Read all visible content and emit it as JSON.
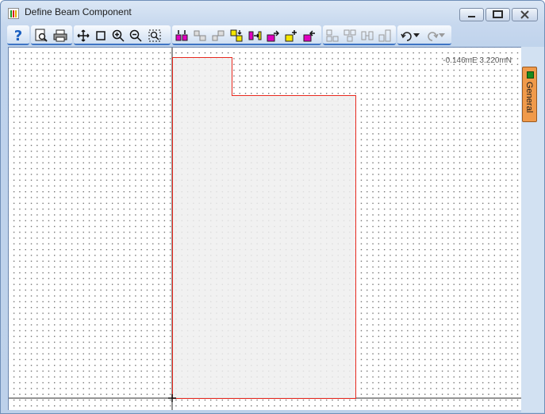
{
  "window": {
    "title": "Define Beam Component"
  },
  "toolbar": {
    "groups": [
      {
        "items": [
          "help-icon"
        ]
      },
      {
        "items": [
          "print-preview-icon",
          "print-icon"
        ]
      },
      {
        "items": [
          "pan-icon",
          "zoom-window-icon",
          "zoom-in-icon",
          "zoom-out-icon",
          "zoom-extents-icon"
        ]
      },
      {
        "items": [
          "tool-1-icon",
          "tool-2-icon",
          "tool-3-icon",
          "tool-4-icon",
          "tool-5-icon",
          "tool-6-icon",
          "tool-7-icon",
          "tool-8-icon"
        ]
      },
      {
        "items": [
          "disabled-tool-1-icon",
          "disabled-tool-2-icon",
          "disabled-tool-3-icon",
          "disabled-tool-4-icon"
        ]
      },
      {
        "items": [
          "undo-icon",
          "undo-dropdown-icon",
          "redo-icon",
          "redo-dropdown-icon"
        ]
      }
    ],
    "help_glyph": "?"
  },
  "canvas": {
    "coordinates": "-0.146mE 3.220mN",
    "shape_stroke": "#e8291f",
    "shape_fill": "#efefef"
  },
  "side_panel": {
    "tab_label": "General",
    "tab_color": "#f09a4a"
  },
  "colors": {
    "accent": "#3d74c4"
  }
}
